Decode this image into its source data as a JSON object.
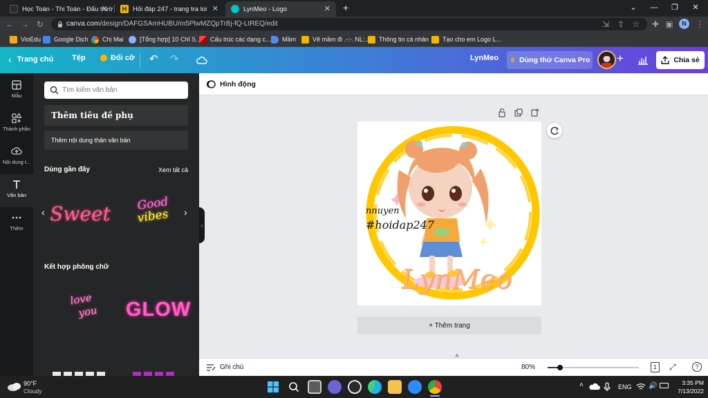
{
  "browser": {
    "tabs": [
      {
        "title": "Học Toán - Thi Toán - Đấu trường",
        "active": false
      },
      {
        "title": "Hỏi đáp 247 - trang tra loi",
        "active": false
      },
      {
        "title": "LynMeo - Logo",
        "active": true
      }
    ],
    "new_tab": "+",
    "url_host": "canva.com",
    "url_path": "/design/DAFGSAmHUBU/m5PlwMZQpTrBj-fQ-LtREQ/edit",
    "profile_initial": "N",
    "bookmarks": [
      "VioEdu",
      "Google Dịch",
      "Chị Mai",
      "[Tổng hợp] 10 Chỉ S...",
      "Cấu trúc các dạng c...",
      "Mầm",
      "Vẽ mầm đi .-:-. NL:..",
      "Thông tin cá nhân",
      "Tạo cho em Logo L..."
    ]
  },
  "header": {
    "home": "Trang chủ",
    "file": "Tệp",
    "resize": "Đổi cỡ",
    "design_name": "LynMeo",
    "try_pro": "Dùng thử Canva Pro",
    "share": "Chia sẻ",
    "colors": {
      "start": "#13b5c6",
      "end": "#6a3fe0"
    }
  },
  "rail": [
    {
      "label": "Mẫu",
      "icon": "template-icon"
    },
    {
      "label": "Thành phần",
      "icon": "elements-icon"
    },
    {
      "label": "Nội dung t...",
      "icon": "upload-icon"
    },
    {
      "label": "Văn bản",
      "icon": "text-icon",
      "active": true
    },
    {
      "label": "Thêm",
      "icon": "more-icon"
    }
  ],
  "panel": {
    "search_placeholder": "Tìm kiếm văn bản",
    "add_subheading": "Thêm tiêu đề phụ",
    "add_body": "Thêm nội dung thân văn bản",
    "recent_title": "Dùng gần đây",
    "see_all": "Xem tất cả",
    "recent_items": [
      "Sweet",
      "Good",
      "vibes"
    ],
    "combos_title": "Kết hợp phông chữ",
    "combo_items": [
      "love",
      "you",
      "GLOW"
    ]
  },
  "editor": {
    "animate": "Hình động",
    "canvas_text": {
      "name": "nnuyen",
      "tag": "#hoidap247",
      "logo": "LynMeo"
    },
    "add_page": "+ Thêm trang",
    "notes": "Ghi chú",
    "zoom": "80%",
    "page_count": "1",
    "help": "?"
  },
  "taskbar": {
    "temp": "90°F",
    "weather": "Cloudy",
    "lang": "ENG",
    "time": "3:35 PM",
    "date": "7/13/2022"
  }
}
